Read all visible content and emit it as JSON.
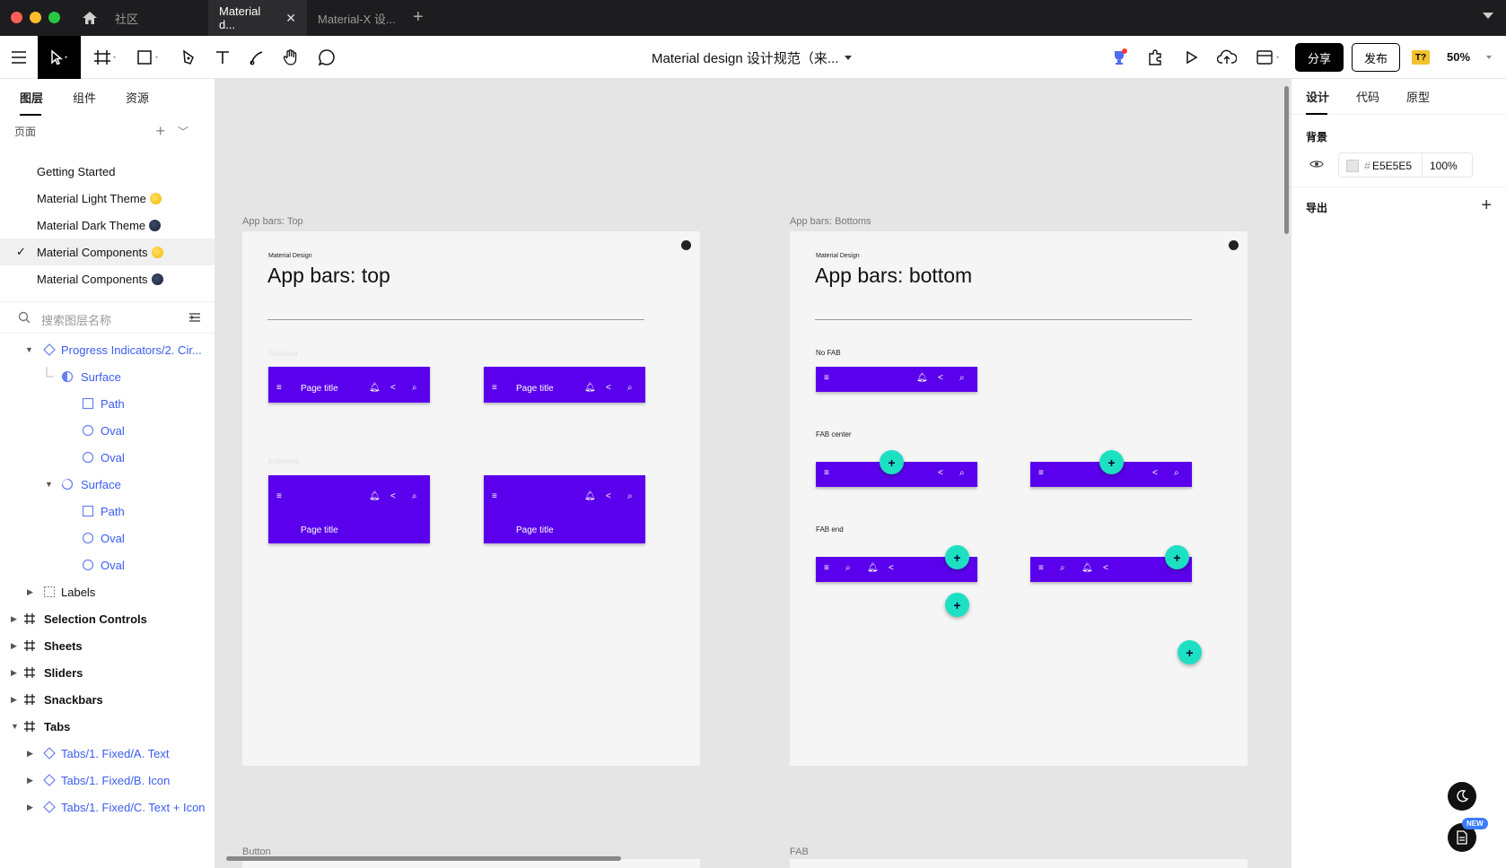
{
  "titlebar": {
    "community": "社区",
    "tabs": [
      {
        "label": "Material d..."
      },
      {
        "label": "Material-X 设..."
      }
    ]
  },
  "toolbar": {
    "doc_title": "Material design 设计规范（来...",
    "share_label": "分享",
    "publish_label": "发布",
    "badge": "T?",
    "zoom": "50%"
  },
  "left_panel": {
    "tabs": [
      "图层",
      "组件",
      "资源"
    ],
    "pages_label": "页面",
    "pages": [
      {
        "label": "Getting Started",
        "emoji": ""
      },
      {
        "label": "Material Light Theme",
        "emoji": "sun"
      },
      {
        "label": "Material Dark Theme",
        "emoji": "moon"
      },
      {
        "label": "Material Components",
        "emoji": "sun",
        "selected": true
      },
      {
        "label": "Material Components",
        "emoji": "moon"
      }
    ],
    "search_placeholder": "搜索图层名称",
    "layers": [
      {
        "label": "Progress Indicators/2. Cir...",
        "kind": "component"
      },
      {
        "label": "Surface",
        "kind": "half"
      },
      {
        "label": "Path",
        "kind": "rect"
      },
      {
        "label": "Oval",
        "kind": "oval"
      },
      {
        "label": "Oval",
        "kind": "oval"
      },
      {
        "label": "Surface",
        "kind": "spinner"
      },
      {
        "label": "Path",
        "kind": "rect"
      },
      {
        "label": "Oval",
        "kind": "oval"
      },
      {
        "label": "Oval",
        "kind": "oval"
      },
      {
        "label": "Labels",
        "kind": "group"
      },
      {
        "label": "Selection Controls",
        "kind": "frame"
      },
      {
        "label": "Sheets",
        "kind": "frame"
      },
      {
        "label": "Sliders",
        "kind": "frame"
      },
      {
        "label": "Snackbars",
        "kind": "frame"
      },
      {
        "label": "Tabs",
        "kind": "frame"
      },
      {
        "label": "Tabs/1. Fixed/A. Text",
        "kind": "component"
      },
      {
        "label": "Tabs/1. Fixed/B. Icon",
        "kind": "component"
      },
      {
        "label": "Tabs/1. Fixed/C. Text + Icon",
        "kind": "component"
      }
    ]
  },
  "canvas": {
    "frames": [
      {
        "label": "App bars: Top",
        "brand": "Material Design",
        "title": "App bars: top"
      },
      {
        "label": "App bars: Bottoms",
        "brand": "Material Design",
        "title": "App bars: bottom"
      }
    ],
    "bottom_labels": [
      "Button",
      "FAB"
    ],
    "top_frame": {
      "page_title": "Page title",
      "section_labels": [
        "Standard",
        "Extended"
      ]
    },
    "bottom_frame": {
      "section_labels": [
        "No FAB",
        "FAB center",
        "FAB end"
      ]
    }
  },
  "right_panel": {
    "tabs": [
      "设计",
      "代码",
      "原型"
    ],
    "background_label": "背景",
    "background_hex": "E5E5E5",
    "background_opacity": "100%",
    "export_label": "导出",
    "new_badge": "NEW"
  },
  "colors": {
    "appbar": "#5A00EC",
    "fab": "#1DE0C3",
    "canvas_bg": "#E5E5E5",
    "layer_blue": "#3A5CF0"
  }
}
